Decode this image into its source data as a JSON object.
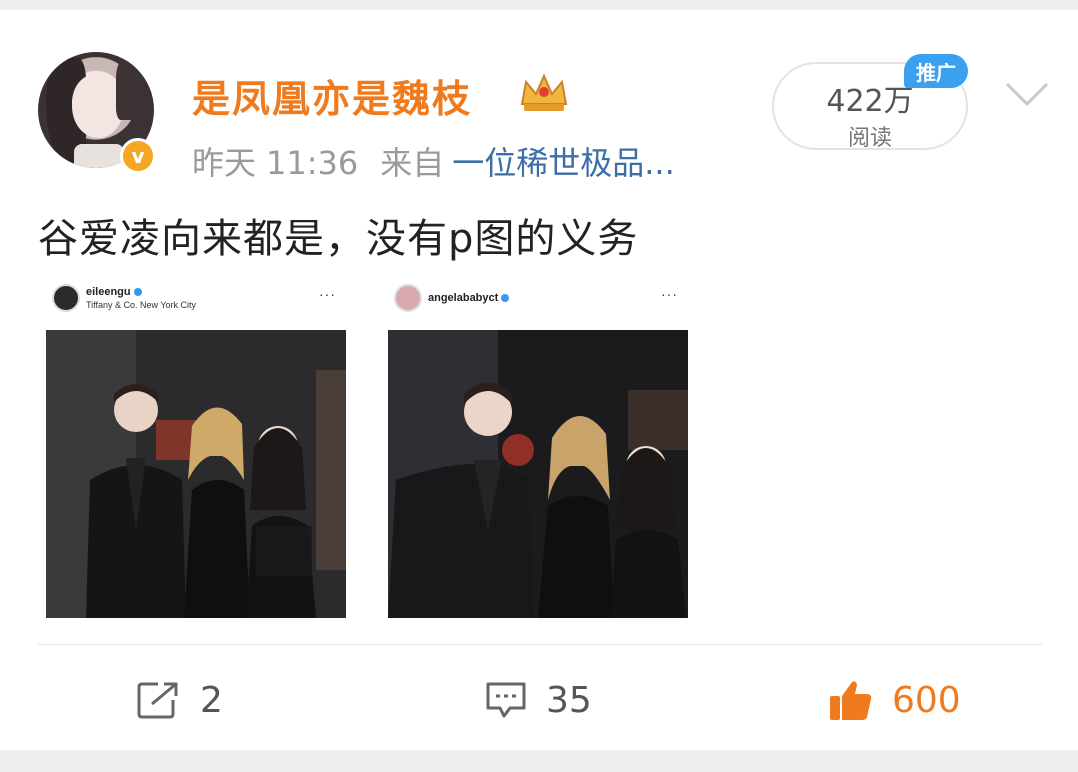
{
  "post": {
    "username": "是凤凰亦是魏枝",
    "verified_mark": "v",
    "time_label": "昨天",
    "time": "11:36",
    "from_label": "来自",
    "source": "一位稀世极品...",
    "text": "谷爱凌向来都是，没有p图的义务",
    "views": {
      "count": "422万",
      "label": "阅读",
      "promo_badge": "推广"
    }
  },
  "images": [
    {
      "ig_username": "eileengu",
      "ig_location": "Tiffany & Co. New York City",
      "ig_more": "···"
    },
    {
      "ig_username": "angelababyct",
      "ig_location": "",
      "ig_more": "···"
    }
  ],
  "actions": {
    "repost_count": "2",
    "comment_count": "35",
    "like_count": "600"
  },
  "colors": {
    "username": "#f07a1e",
    "source_link": "#3d6ea8",
    "promo_badge": "#3aa0f0",
    "like_active": "#f07a1e"
  }
}
